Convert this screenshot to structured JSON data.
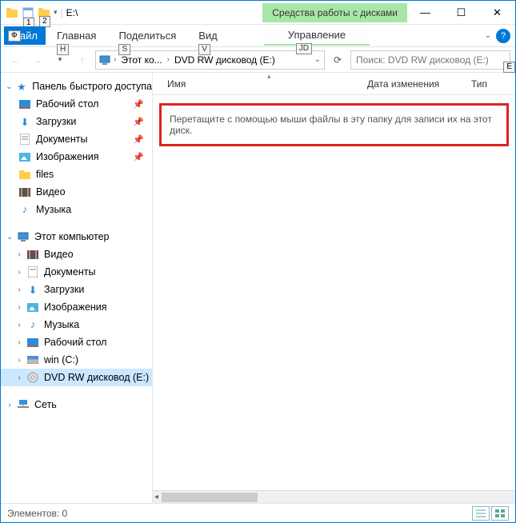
{
  "window": {
    "title": "E:\\",
    "context_tab": "Средства работы с дисками"
  },
  "key_tips": {
    "qat1": "1",
    "qat2": "2",
    "file": "Ф",
    "home": "Н",
    "share": "S",
    "view": "V",
    "manage": "JD",
    "search": "Е"
  },
  "tabs": {
    "file": "Файл",
    "home": "Главная",
    "share": "Поделиться",
    "view": "Вид",
    "manage": "Управление"
  },
  "addressbar": {
    "crumb1": "Этот ко...",
    "crumb2": "DVD RW дисковод (E:)"
  },
  "search": {
    "placeholder": "Поиск: DVD RW дисковод (E:)"
  },
  "nav": {
    "quick_access": "Панель быстрого доступа",
    "desktop": "Рабочий стол",
    "downloads": "Загрузки",
    "documents": "Документы",
    "pictures": "Изображения",
    "files": "files",
    "videos": "Видео",
    "music": "Музыка",
    "this_pc": "Этот компьютер",
    "pc_videos": "Видео",
    "pc_documents": "Документы",
    "pc_downloads": "Загрузки",
    "pc_pictures": "Изображения",
    "pc_music": "Музыка",
    "pc_desktop": "Рабочий стол",
    "drive_c": "win (C:)",
    "drive_e": "DVD RW дисковод (E:)",
    "network": "Сеть"
  },
  "columns": {
    "name": "Имя",
    "date": "Дата изменения",
    "type": "Тип"
  },
  "hint": "Перетащите с помощью мыши файлы в эту папку для записи их на этот диск.",
  "status": {
    "items": "Элементов: 0"
  }
}
